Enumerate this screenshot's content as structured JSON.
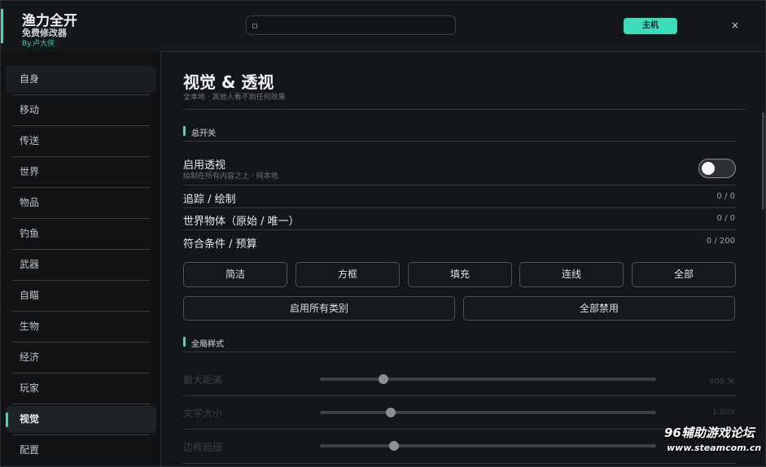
{
  "app": {
    "title": "渔力全开",
    "subtitle": "免费修改器",
    "byline": "By.卢大侠",
    "search_placeholder": "",
    "host_label": "主机",
    "close_label": "×"
  },
  "sidebar": {
    "items": [
      {
        "label": "自身"
      },
      {
        "label": "移动"
      },
      {
        "label": "传送"
      },
      {
        "label": "世界"
      },
      {
        "label": "物品"
      },
      {
        "label": "钓鱼"
      },
      {
        "label": "武器"
      },
      {
        "label": "自瞄"
      },
      {
        "label": "生物"
      },
      {
        "label": "经济"
      },
      {
        "label": "玩家"
      },
      {
        "label": "视觉"
      },
      {
        "label": "配置"
      }
    ],
    "active_index": 11
  },
  "page": {
    "title": "视觉 & 透视",
    "subtitle": "全本地 · 其他人看不到任何效果"
  },
  "master": {
    "section_label": "总开关",
    "enable_label": "启用透视",
    "enable_hint": "绘制在所有内容之上 · 纯本地",
    "enable_on": false,
    "stats": [
      {
        "label": "追踪 / 绘制",
        "value": "0 / 0"
      },
      {
        "label": "世界物体（原始 / 唯一）",
        "value": "0 / 0"
      },
      {
        "label": "符合条件 / 预算",
        "value": "0 / 200"
      }
    ],
    "presets": [
      "简洁",
      "方框",
      "填充",
      "连线",
      "全部"
    ],
    "enable_all_label": "启用所有类别",
    "disable_all_label": "全部禁用"
  },
  "global_style": {
    "section_label": "全局样式",
    "sliders": [
      {
        "label": "最大距离",
        "value_text": "400 米",
        "fraction": 0.19
      },
      {
        "label": "文字大小",
        "value_text": "1.00x",
        "fraction": 0.21
      },
      {
        "label": "边框粗细",
        "value_text": "",
        "fraction": 0.22
      }
    ]
  },
  "watermark": {
    "line1": "96辅助游戏论坛",
    "line2": "www.steamcom.cn"
  },
  "colors": {
    "accent": "#3ddbb7",
    "background": "#14171a"
  }
}
